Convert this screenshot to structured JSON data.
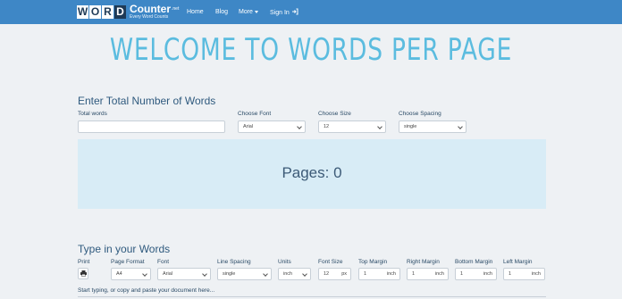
{
  "nav": {
    "logo_letters": [
      "W",
      "O",
      "R",
      "D"
    ],
    "brand_name": "Counter",
    "brand_tld": ".net",
    "brand_tagline": "Every Word Counts",
    "home": "Home",
    "blog": "Blog",
    "more": "More",
    "signin": "Sign In"
  },
  "hero": {
    "title": "WELCOME TO WORDS PER PAGE"
  },
  "calculator": {
    "title": "Enter Total Number of Words",
    "total_words_label": "Total words",
    "total_words_value": "",
    "font_label": "Choose Font",
    "font_value": "Arial",
    "size_label": "Choose Size",
    "size_value": "12",
    "spacing_label": "Choose Spacing",
    "spacing_value": "single"
  },
  "result": {
    "pages_text": "Pages: 0"
  },
  "editor": {
    "title": "Type in your Words",
    "print_label": "Print",
    "page_format_label": "Page Format",
    "page_format_value": "A4",
    "font_label": "Font",
    "font_value": "Arial",
    "line_spacing_label": "Line Spacing",
    "line_spacing_value": "single",
    "units_label": "Units",
    "units_value": "inch",
    "font_size_label": "Font Size",
    "font_size_value": "12",
    "font_size_unit": "px",
    "top_margin_label": "Top Margin",
    "top_margin_value": "1",
    "right_margin_label": "Right Margin",
    "right_margin_value": "1",
    "bottom_margin_label": "Bottom Margin",
    "bottom_margin_value": "1",
    "left_margin_label": "Left Margin",
    "left_margin_value": "1",
    "margin_unit": "inch",
    "placeholder": "Start typing, or copy and paste your document here..."
  },
  "colors": {
    "navbar": "#3e87c6",
    "title": "#5bbcdf",
    "result_bg": "#d8ecf6",
    "page_bg": "#eef1f4"
  }
}
